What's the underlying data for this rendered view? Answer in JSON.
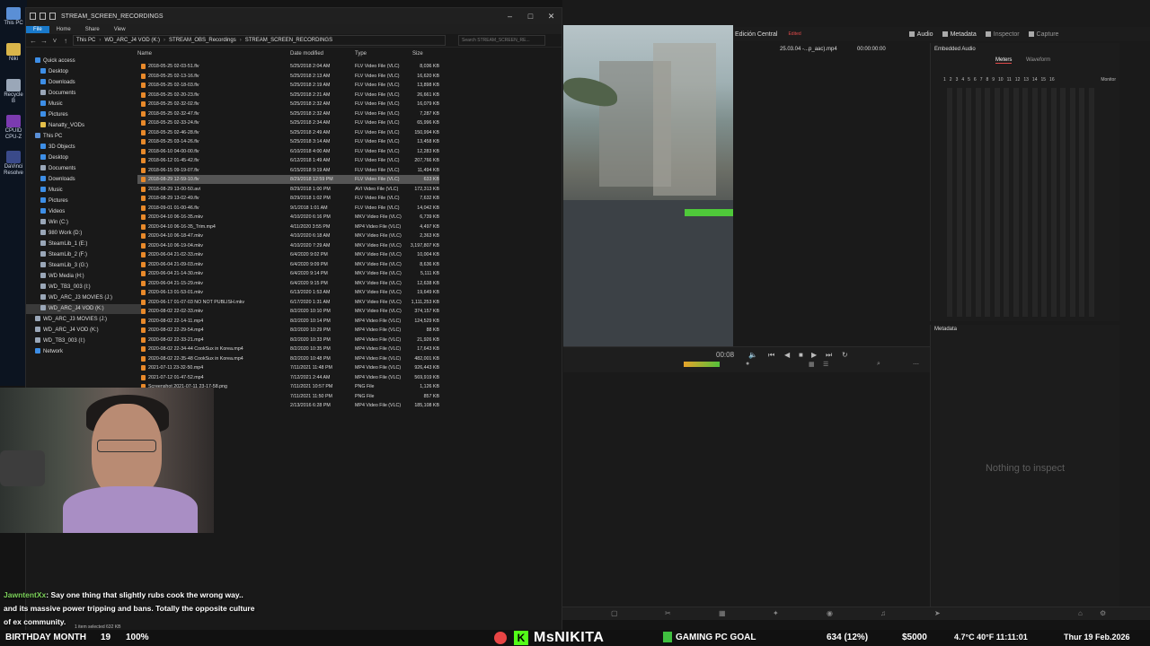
{
  "desktop": {
    "icons": [
      {
        "label": "This PC",
        "color": "#5a8fd6"
      },
      {
        "label": "Niki",
        "color": "#d9b54a"
      },
      {
        "label": "Recycle B",
        "color": "#9aa7b8"
      },
      {
        "label": "CPUID CPU-Z",
        "color": "#7b3bb0"
      },
      {
        "label": "DaVinci Resolve",
        "color": "#3a4a8a"
      }
    ]
  },
  "explorer": {
    "title": "STREAM_SCREEN_RECORDINGS",
    "ribbon": [
      "File",
      "Home",
      "Share",
      "View"
    ],
    "path": [
      "This PC",
      "WD_ARC_J4 VOD (K:)",
      "STREAM_OBS_Recordings",
      "STREAM_SCREEN_RECORDINGS"
    ],
    "search_placeholder": "Search STREAM_SCREEN_RE...",
    "columns": {
      "name": "Name",
      "date": "Date modified",
      "type": "Type",
      "size": "Size"
    },
    "nav": [
      {
        "label": "Quick access",
        "color": "#3d8ee6",
        "indent": 10
      },
      {
        "label": "Desktop",
        "color": "#3d8ee6",
        "indent": 16
      },
      {
        "label": "Downloads",
        "color": "#3d8ee6",
        "indent": 16
      },
      {
        "label": "Documents",
        "color": "#9aa7b8",
        "indent": 16
      },
      {
        "label": "Music",
        "color": "#3d8ee6",
        "indent": 16
      },
      {
        "label": "Pictures",
        "color": "#3d8ee6",
        "indent": 16
      },
      {
        "label": "Nanatty_VODs",
        "color": "#e6c04a",
        "indent": 16
      },
      {
        "label": "This PC",
        "color": "#5a8fd6",
        "indent": 10
      },
      {
        "label": "3D Objects",
        "color": "#3d8ee6",
        "indent": 16
      },
      {
        "label": "Desktop",
        "color": "#3d8ee6",
        "indent": 16
      },
      {
        "label": "Documents",
        "color": "#9aa7b8",
        "indent": 16
      },
      {
        "label": "Downloads",
        "color": "#3d8ee6",
        "indent": 16
      },
      {
        "label": "Music",
        "color": "#3d8ee6",
        "indent": 16
      },
      {
        "label": "Pictures",
        "color": "#3d8ee6",
        "indent": 16
      },
      {
        "label": "Videos",
        "color": "#3d8ee6",
        "indent": 16
      },
      {
        "label": "Win (C:)",
        "color": "#9aa7b8",
        "indent": 16
      },
      {
        "label": "980 Work (D:)",
        "color": "#9aa7b8",
        "indent": 16
      },
      {
        "label": "SteamLib_1 (E:)",
        "color": "#9aa7b8",
        "indent": 16
      },
      {
        "label": "SteamLib_2 (F:)",
        "color": "#9aa7b8",
        "indent": 16
      },
      {
        "label": "SteamLib_3 (G:)",
        "color": "#9aa7b8",
        "indent": 16
      },
      {
        "label": "WD Media (H:)",
        "color": "#9aa7b8",
        "indent": 16
      },
      {
        "label": "WD_TB3_003 (I:)",
        "color": "#9aa7b8",
        "indent": 16
      },
      {
        "label": "WD_ARC_J3 MOVIES (J:)",
        "color": "#9aa7b8",
        "indent": 16
      },
      {
        "label": "WD_ARC_J4 VOD (K:)",
        "color": "#9aa7b8",
        "indent": 16,
        "selected": true
      },
      {
        "label": "WD_ARC_J3 MOVIES (J:)",
        "color": "#9aa7b8",
        "indent": 10
      },
      {
        "label": "WD_ARC_J4 VOD (K:)",
        "color": "#9aa7b8",
        "indent": 10
      },
      {
        "label": "WD_TB3_003 (I:)",
        "color": "#9aa7b8",
        "indent": 10
      },
      {
        "label": "Network",
        "color": "#3d8ee6",
        "indent": 10
      }
    ],
    "files": [
      {
        "name": "2018-05-25 02-03-51.flv",
        "date": "5/25/2018 2:04 AM",
        "type": "FLV Video File (VLC)",
        "size": "8,036 KB"
      },
      {
        "name": "2018-05-25 02-13-16.flv",
        "date": "5/25/2018 2:13 AM",
        "type": "FLV Video File (VLC)",
        "size": "16,620 KB"
      },
      {
        "name": "2018-05-25 02-18-03.flv",
        "date": "5/25/2018 2:19 AM",
        "type": "FLV Video File (VLC)",
        "size": "13,898 KB"
      },
      {
        "name": "2018-05-25 02-20-23.flv",
        "date": "5/25/2018 2:21 AM",
        "type": "FLV Video File (VLC)",
        "size": "26,661 KB"
      },
      {
        "name": "2018-05-25 02-32-02.flv",
        "date": "5/25/2018 2:32 AM",
        "type": "FLV Video File (VLC)",
        "size": "16,079 KB"
      },
      {
        "name": "2018-05-25 02-32-47.flv",
        "date": "5/25/2018 2:32 AM",
        "type": "FLV Video File (VLC)",
        "size": "7,287 KB"
      },
      {
        "name": "2018-05-25 02-33-24.flv",
        "date": "5/25/2018 2:34 AM",
        "type": "FLV Video File (VLC)",
        "size": "65,996 KB"
      },
      {
        "name": "2018-05-25 02-46-28.flv",
        "date": "5/25/2018 2:49 AM",
        "type": "FLV Video File (VLC)",
        "size": "150,994 KB"
      },
      {
        "name": "2018-05-25 03-14-26.flv",
        "date": "5/25/2018 3:14 AM",
        "type": "FLV Video File (VLC)",
        "size": "13,458 KB"
      },
      {
        "name": "2018-06-10 04-00-00.flv",
        "date": "6/10/2018 4:00 AM",
        "type": "FLV Video File (VLC)",
        "size": "12,283 KB"
      },
      {
        "name": "2018-06-12 01-45-42.flv",
        "date": "6/12/2018 1:49 AM",
        "type": "FLV Video File (VLC)",
        "size": "207,766 KB"
      },
      {
        "name": "2018-06-15 09-19-07.flv",
        "date": "6/15/2018 9:19 AM",
        "type": "FLV Video File (VLC)",
        "size": "11,494 KB"
      },
      {
        "name": "2018-08-29 12-59-10.flv",
        "date": "8/29/2018 12:59 PM",
        "type": "FLV Video File (VLC)",
        "size": "633 KB",
        "selected": true
      },
      {
        "name": "2018-08-29 13-00-50.avi",
        "date": "8/29/2018 1:00 PM",
        "type": "AVI Video File (VLC)",
        "size": "172,313 KB"
      },
      {
        "name": "2018-08-29 13-02-49.flv",
        "date": "8/29/2018 1:02 PM",
        "type": "FLV Video File (VLC)",
        "size": "7,632 KB"
      },
      {
        "name": "2018-09-01 01-00-46.flv",
        "date": "9/1/2018 1:01 AM",
        "type": "FLV Video File (VLC)",
        "size": "14,042 KB"
      },
      {
        "name": "2020-04-10 06-16-35.mkv",
        "date": "4/10/2020 6:16 PM",
        "type": "MKV Video File (VLC)",
        "size": "6,739 KB"
      },
      {
        "name": "2020-04-10 06-16-35_Trim.mp4",
        "date": "4/11/2020 3:55 PM",
        "type": "MP4 Video File (VLC)",
        "size": "4,497 KB"
      },
      {
        "name": "2020-04-10 06-18-47.mkv",
        "date": "4/10/2020 6:18 AM",
        "type": "MKV Video File (VLC)",
        "size": "2,363 KB"
      },
      {
        "name": "2020-04-10 06-19-04.mkv",
        "date": "4/10/2020 7:29 AM",
        "type": "MKV Video File (VLC)",
        "size": "3,197,807 KB"
      },
      {
        "name": "2020-06-04 21-02-33.mkv",
        "date": "6/4/2020 9:02 PM",
        "type": "MKV Video File (VLC)",
        "size": "10,004 KB"
      },
      {
        "name": "2020-06-04 21-09-03.mkv",
        "date": "6/4/2020 9:09 PM",
        "type": "MKV Video File (VLC)",
        "size": "8,636 KB"
      },
      {
        "name": "2020-06-04 21-14-30.mkv",
        "date": "6/4/2020 9:14 PM",
        "type": "MKV Video File (VLC)",
        "size": "5,111 KB"
      },
      {
        "name": "2020-06-04 21-15-29.mkv",
        "date": "6/4/2020 9:15 PM",
        "type": "MKV Video File (VLC)",
        "size": "12,638 KB"
      },
      {
        "name": "2020-06-13 01-53-01.mkv",
        "date": "6/13/2020 1:53 AM",
        "type": "MKV Video File (VLC)",
        "size": "19,649 KB"
      },
      {
        "name": "2020-06-17 01-07-03 NO NOT PUBLISH.mkv",
        "date": "6/17/2020 1:31 AM",
        "type": "MKV Video File (VLC)",
        "size": "1,111,253 KB"
      },
      {
        "name": "2020-08-02 22-02-33.mkv",
        "date": "8/2/2020 10:10 PM",
        "type": "MKV Video File (VLC)",
        "size": "374,157 KB"
      },
      {
        "name": "2020-08-02 22-14-11.mp4",
        "date": "8/2/2020 10:14 PM",
        "type": "MP4 Video File (VLC)",
        "size": "124,529 KB"
      },
      {
        "name": "2020-08-02 22-29-54.mp4",
        "date": "8/2/2020 10:29 PM",
        "type": "MP4 Video File (VLC)",
        "size": "88 KB"
      },
      {
        "name": "2020-08-02 22-33-21.mp4",
        "date": "8/2/2020 10:33 PM",
        "type": "MP4 Video File (VLC)",
        "size": "21,926 KB"
      },
      {
        "name": "2020-08-02 22-34-44 CookSux in Korea.mp4",
        "date": "8/2/2020 10:35 PM",
        "type": "MP4 Video File (VLC)",
        "size": "17,643 KB"
      },
      {
        "name": "2020-08-02 22-35-48 CookSux in Korea.mp4",
        "date": "8/2/2020 10:48 PM",
        "type": "MP4 Video File (VLC)",
        "size": "482,001 KB"
      },
      {
        "name": "2021-07-11 23-32-50.mp4",
        "date": "7/11/2021 11:48 PM",
        "type": "MP4 Video File (VLC)",
        "size": "926,443 KB"
      },
      {
        "name": "2021-07-12 01-47-52.mp4",
        "date": "7/12/2021 2:44 AM",
        "type": "MP4 Video File (VLC)",
        "size": "569,919 KB"
      },
      {
        "name": "Screenshot 2021-07-11 23-17-58.png",
        "date": "7/11/2021 10:57 PM",
        "type": "PNG File",
        "size": "1,126 KB"
      },
      {
        "name": "-05.png",
        "date": "7/11/2021 11:50 PM",
        "type": "PNG File",
        "size": "857 KB"
      },
      {
        "name": "mp4",
        "date": "2/13/2016 6:28 PM",
        "type": "MP4 Video File (VLC)",
        "size": "185,108 KB"
      }
    ],
    "status": "1 item selected  632 KB"
  },
  "resolve": {
    "title": "Edición Central",
    "edited": "Edited",
    "tabs": [
      "Audio",
      "Metadata",
      "Inspector",
      "Capture"
    ],
    "clip_name": "25.03.04 -...p_aac).mp4",
    "timecode": "00:00:00:00",
    "playhead": "00:08",
    "audio_header": "Embedded Audio",
    "meter_tabs": [
      "Meters",
      "Waveform"
    ],
    "channels": [
      "1",
      "2",
      "3",
      "4",
      "5",
      "6",
      "7",
      "8",
      "9",
      "10",
      "11",
      "12",
      "13",
      "14",
      "15",
      "16"
    ],
    "monitor_label": "Monitor",
    "metadata_header": "Metadata",
    "empty_text": "Nothing to inspect",
    "accent": "#e04a4a"
  },
  "chat": {
    "user": "JawntentXx",
    "message": ": Say one thing that slightly rubs cook the wrong way..",
    "line2": "and its massive power tripping and bans. Totally the opposite culture",
    "line3": "of ex community."
  },
  "overlay": {
    "birthday": "BIRTHDAY MONTH",
    "count": "19",
    "percent": "100%",
    "streamer": "MsNIKITA",
    "k_logo": "K",
    "goal": "GAMING PC GOAL",
    "stats": "634 (12%)",
    "money": "$5000",
    "weather": "4.7°C  40°F  11:11:01",
    "date": "Thur 19 Feb.2026",
    "kick_color": "#53fc18"
  }
}
